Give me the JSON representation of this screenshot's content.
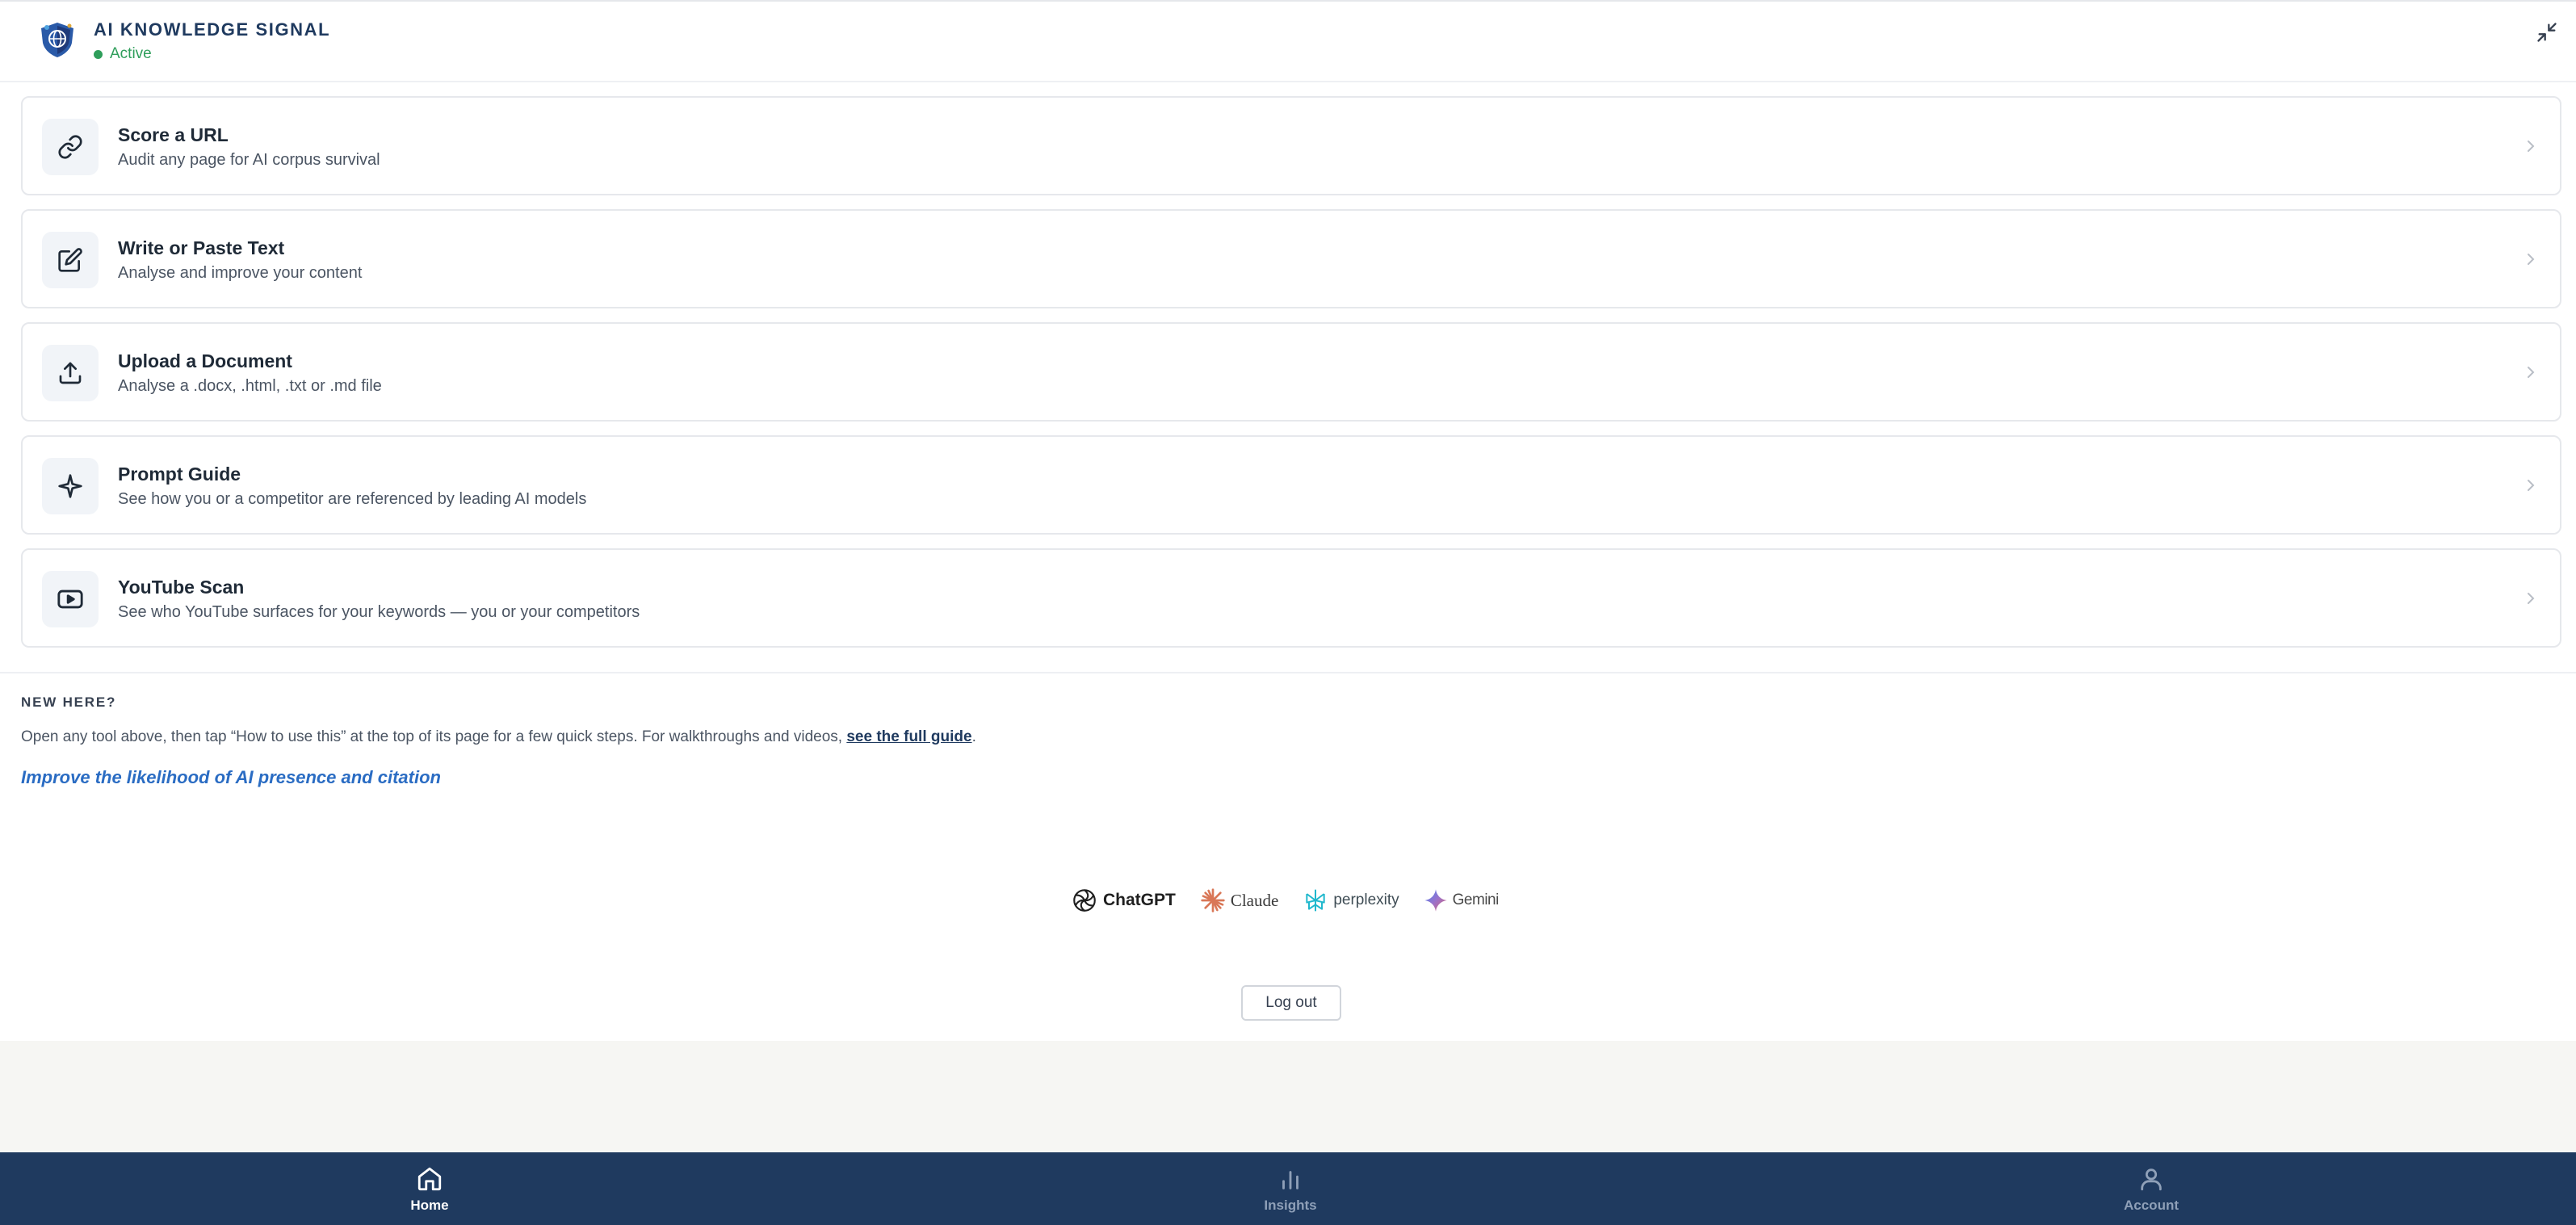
{
  "header": {
    "title": "AI KNOWLEDGE SIGNAL",
    "status": "Active",
    "logo_icon": "shield-globe-icon",
    "collapse_icon": "collapse-arrows-icon"
  },
  "tools": [
    {
      "title": "Score a URL",
      "subtitle": "Audit any page for AI corpus survival",
      "icon": "link-icon"
    },
    {
      "title": "Write or Paste Text",
      "subtitle": "Analyse and improve your content",
      "icon": "edit-icon"
    },
    {
      "title": "Upload a Document",
      "subtitle": "Analyse a .docx, .html, .txt or .md file",
      "icon": "upload-icon"
    },
    {
      "title": "Prompt Guide",
      "subtitle": "See how you or a competitor are referenced by leading AI models",
      "icon": "sparkle-icon"
    },
    {
      "title": "YouTube Scan",
      "subtitle": "See who YouTube surfaces for your keywords — you or your competitors",
      "icon": "youtube-icon"
    }
  ],
  "new_here": {
    "heading": "NEW HERE?",
    "text_before": "Open any tool above, then tap “How to use this” at the top of its page for a few quick steps. For walkthroughs and videos, ",
    "link_text": "see the full guide",
    "text_after": ".",
    "improve_link": "Improve the likelihood of AI presence and citation"
  },
  "ai_models": [
    "ChatGPT",
    "Claude",
    "perplexity",
    "Gemini"
  ],
  "logout_label": "Log out",
  "nav": [
    {
      "label": "Home",
      "icon": "home-icon",
      "active": true
    },
    {
      "label": "Insights",
      "icon": "bar-chart-icon",
      "active": false
    },
    {
      "label": "Account",
      "icon": "user-icon",
      "active": false
    }
  ],
  "colors": {
    "navy": "#1f3a5f",
    "active_green": "#2f9e5b",
    "link_blue": "#2a6cc3",
    "claude_orange": "#d97757",
    "perplexity_teal": "#20b8cd"
  }
}
